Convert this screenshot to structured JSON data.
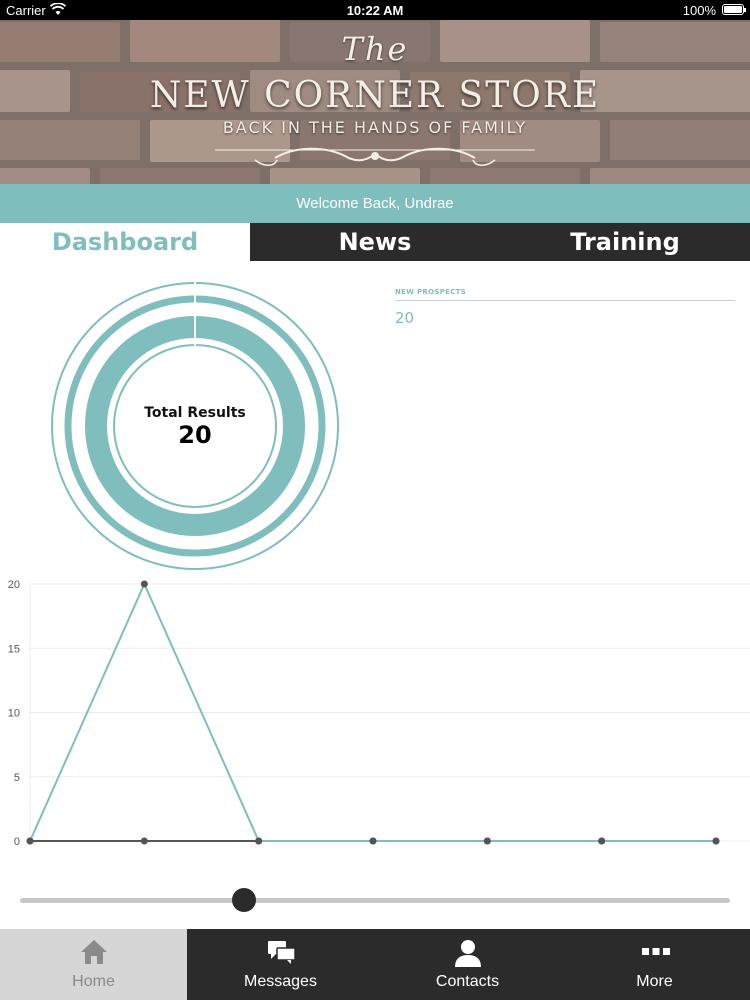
{
  "status_bar": {
    "carrier": "Carrier",
    "time": "10:22 AM",
    "battery": "100%"
  },
  "banner": {
    "the": "The",
    "name": "NEW CORNER STORE",
    "tagline": "BACK IN THE HANDS OF FAMILY"
  },
  "welcome": "Welcome Back, Undrae",
  "tabs": [
    {
      "label": "Dashboard"
    },
    {
      "label": "News"
    },
    {
      "label": "Training"
    }
  ],
  "donut": {
    "label": "Total Results",
    "value": "20"
  },
  "prospects": {
    "title": "NEW PROSPECTS",
    "value": "20"
  },
  "chart_data": {
    "type": "line",
    "x": [
      1,
      2,
      3,
      4,
      5,
      6,
      7
    ],
    "series": [
      {
        "values": [
          0,
          20,
          0,
          0,
          0,
          0,
          0
        ],
        "color": "#7fbebd"
      },
      {
        "values": [
          0,
          0,
          0,
          0,
          0,
          0,
          0
        ],
        "color": "#555555"
      }
    ],
    "yticks": [
      "0",
      "5",
      "10",
      "15",
      "20"
    ],
    "ylim": [
      0,
      20
    ],
    "grid": true
  },
  "slider": {
    "value_fraction": 0.315
  },
  "bottom_nav": [
    {
      "label": "Home",
      "icon": "home-icon"
    },
    {
      "label": "Messages",
      "icon": "messages-icon"
    },
    {
      "label": "Contacts",
      "icon": "contacts-icon"
    },
    {
      "label": "More",
      "icon": "more-icon"
    }
  ],
  "colors": {
    "accent": "#7fbebd",
    "dark": "#2b2b2b"
  }
}
